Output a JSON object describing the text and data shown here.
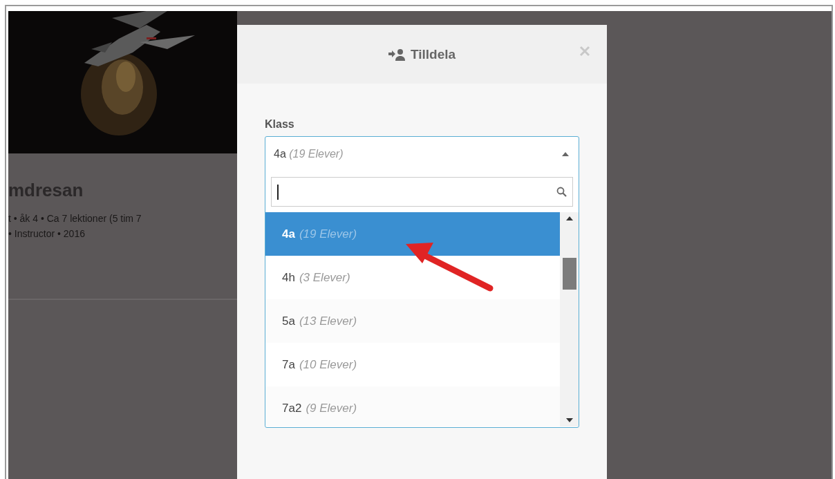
{
  "background_card": {
    "title": "mdresan",
    "meta": [
      "t • åk 4 • Ca 7 lektioner (5 tim 7",
      "• Instructor • 2016"
    ]
  },
  "dialog": {
    "title": "Tilldela",
    "field_label": "Klass",
    "select": {
      "value": "4a",
      "value_note": "(19 Elever)",
      "expanded": true
    },
    "options": [
      {
        "label": "4a",
        "note": "(19 Elever)",
        "selected": true
      },
      {
        "label": "4h",
        "note": "(3 Elever)",
        "selected": false
      },
      {
        "label": "5a",
        "note": "(13 Elever)",
        "selected": false
      },
      {
        "label": "7a",
        "note": "(10 Elever)",
        "selected": false
      },
      {
        "label": "7a2",
        "note": "(9 Elever)",
        "selected": false
      }
    ]
  }
}
